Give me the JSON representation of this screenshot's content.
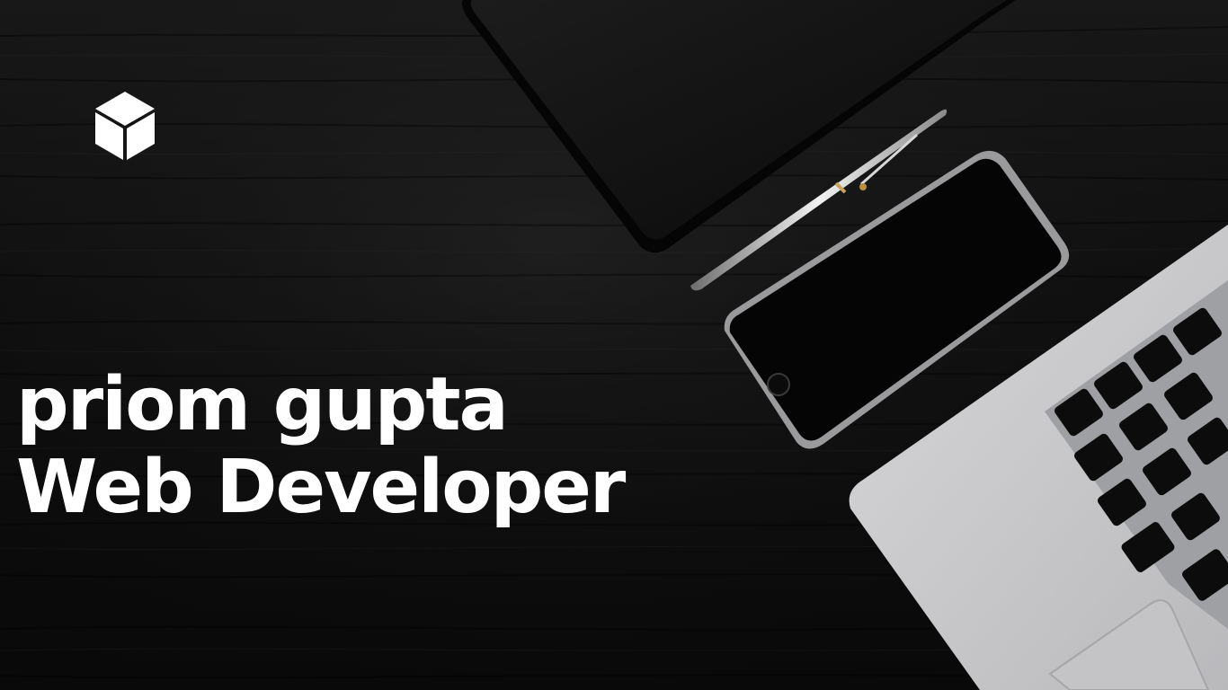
{
  "headline": {
    "name": "priom gupta",
    "role": "Web Developer"
  },
  "logo": {
    "icon": "cube-icon",
    "color": "#ffffff"
  },
  "colors": {
    "background": "#0d0d0d",
    "text": "#ffffff",
    "laptop": "#c9c9cb",
    "keys": "#111111"
  }
}
